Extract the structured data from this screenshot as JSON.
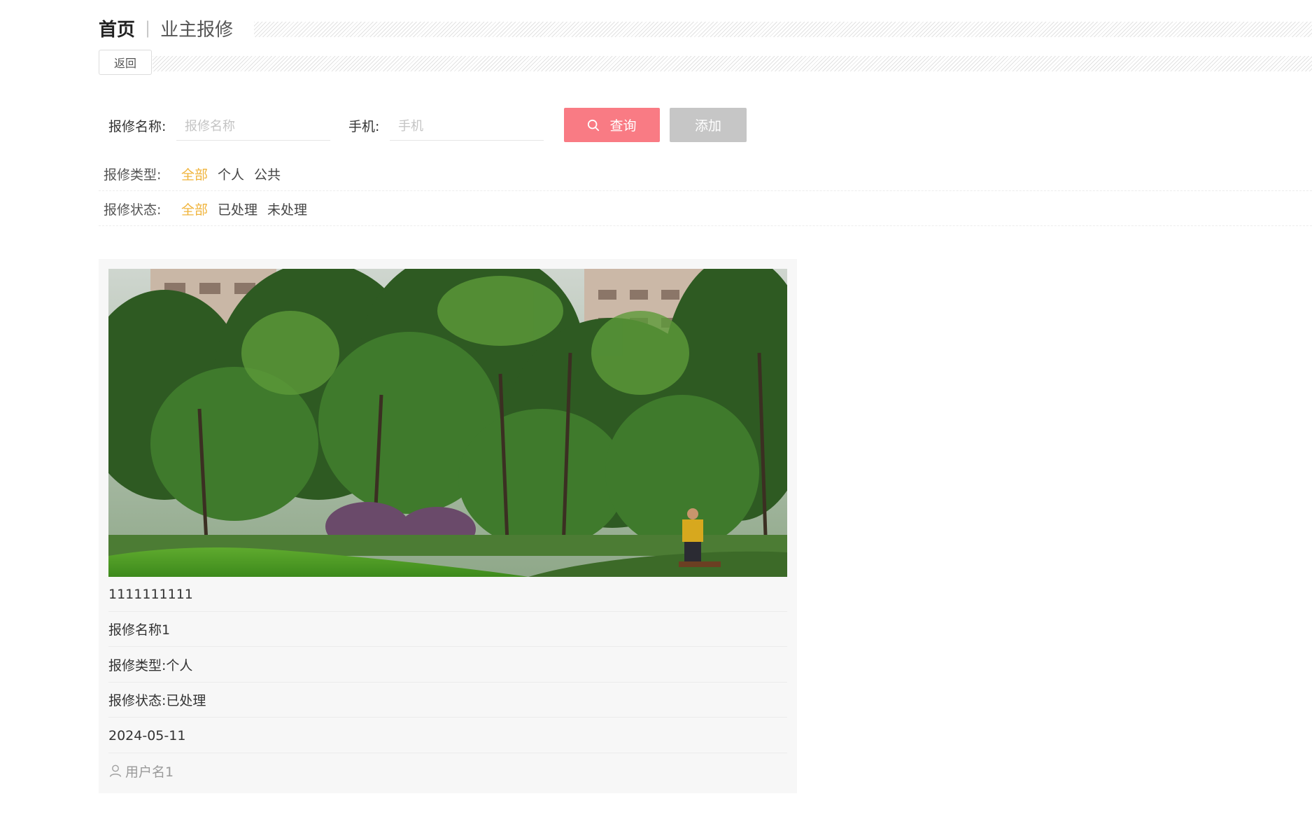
{
  "breadcrumb": {
    "home": "首页",
    "separator": "|",
    "current": "业主报修"
  },
  "back_button": "返回",
  "search": {
    "name_label": "报修名称:",
    "name_placeholder": "报修名称",
    "phone_label": "手机:",
    "phone_placeholder": "手机",
    "query_button": "查询",
    "add_button": "添加"
  },
  "filters": {
    "type": {
      "label": "报修类型:",
      "options": [
        "全部",
        "个人",
        "公共"
      ],
      "active": "全部"
    },
    "status": {
      "label": "报修状态:",
      "options": [
        "全部",
        "已处理",
        "未处理"
      ],
      "active": "全部"
    }
  },
  "card": {
    "image_icon": "garden-photo",
    "phone": "1111111111",
    "name": "报修名称1",
    "type": "报修类型:个人",
    "status": "报修状态:已处理",
    "date": "2024-05-11",
    "user_icon": "user-icon",
    "username": "用户名1"
  },
  "colors": {
    "accent_active": "#f0b43c",
    "query_button": "#f97b84",
    "add_button": "#c6c6c6",
    "card_bg": "#f7f7f7"
  }
}
